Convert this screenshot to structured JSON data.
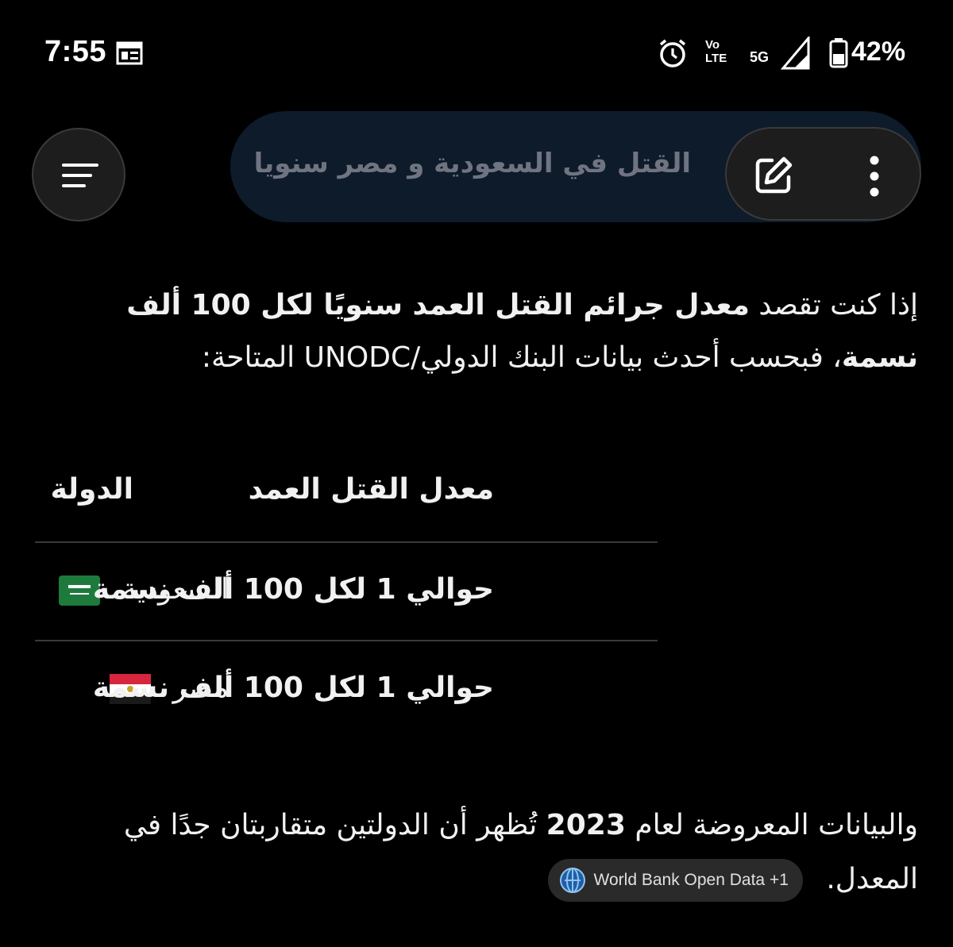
{
  "status_bar": {
    "time": "7:55",
    "battery": "42%",
    "network": "5G",
    "volte_top": "Vo",
    "volte_bottom": "LTE"
  },
  "search": {
    "query": "القتل في السعودية و مصر سنويا"
  },
  "icons": {
    "menu": "menu-icon",
    "edit": "edit-icon",
    "more": "more-vert-icon",
    "alarm": "alarm-icon",
    "news": "news-icon",
    "signal": "signal-icon",
    "battery": "battery-icon",
    "source": "globe-icon"
  },
  "intro": {
    "part1": "إذا كنت تقصد ",
    "bold": "معدل جرائم القتل العمد سنويًا لكل 100 ألف نسمة",
    "part2": "، فبحسب أحدث بيانات البنك الدولي/UNODC المتاحة:"
  },
  "table": {
    "headers": {
      "country": "الدولة",
      "rate": "معدل القتل العمد"
    },
    "rows": [
      {
        "country": "السعودية",
        "rate": "حوالي 1 لكل 100 ألف نسمة"
      },
      {
        "country": "مصر",
        "rate": "حوالي 1 لكل 100 ألف نسمة"
      }
    ]
  },
  "outro": {
    "part1": "والبيانات المعروضة لعام ",
    "year": "2023",
    "part2": " تُظهر أن الدولتين متقاربتان جدًا في المعدل.",
    "source_chip": "World Bank Open Data +1"
  },
  "colors": {
    "background": "#000000",
    "search_bg": "#0d1b2b",
    "pill_bg": "#1d1d1d",
    "text": "#f1f1f1"
  }
}
